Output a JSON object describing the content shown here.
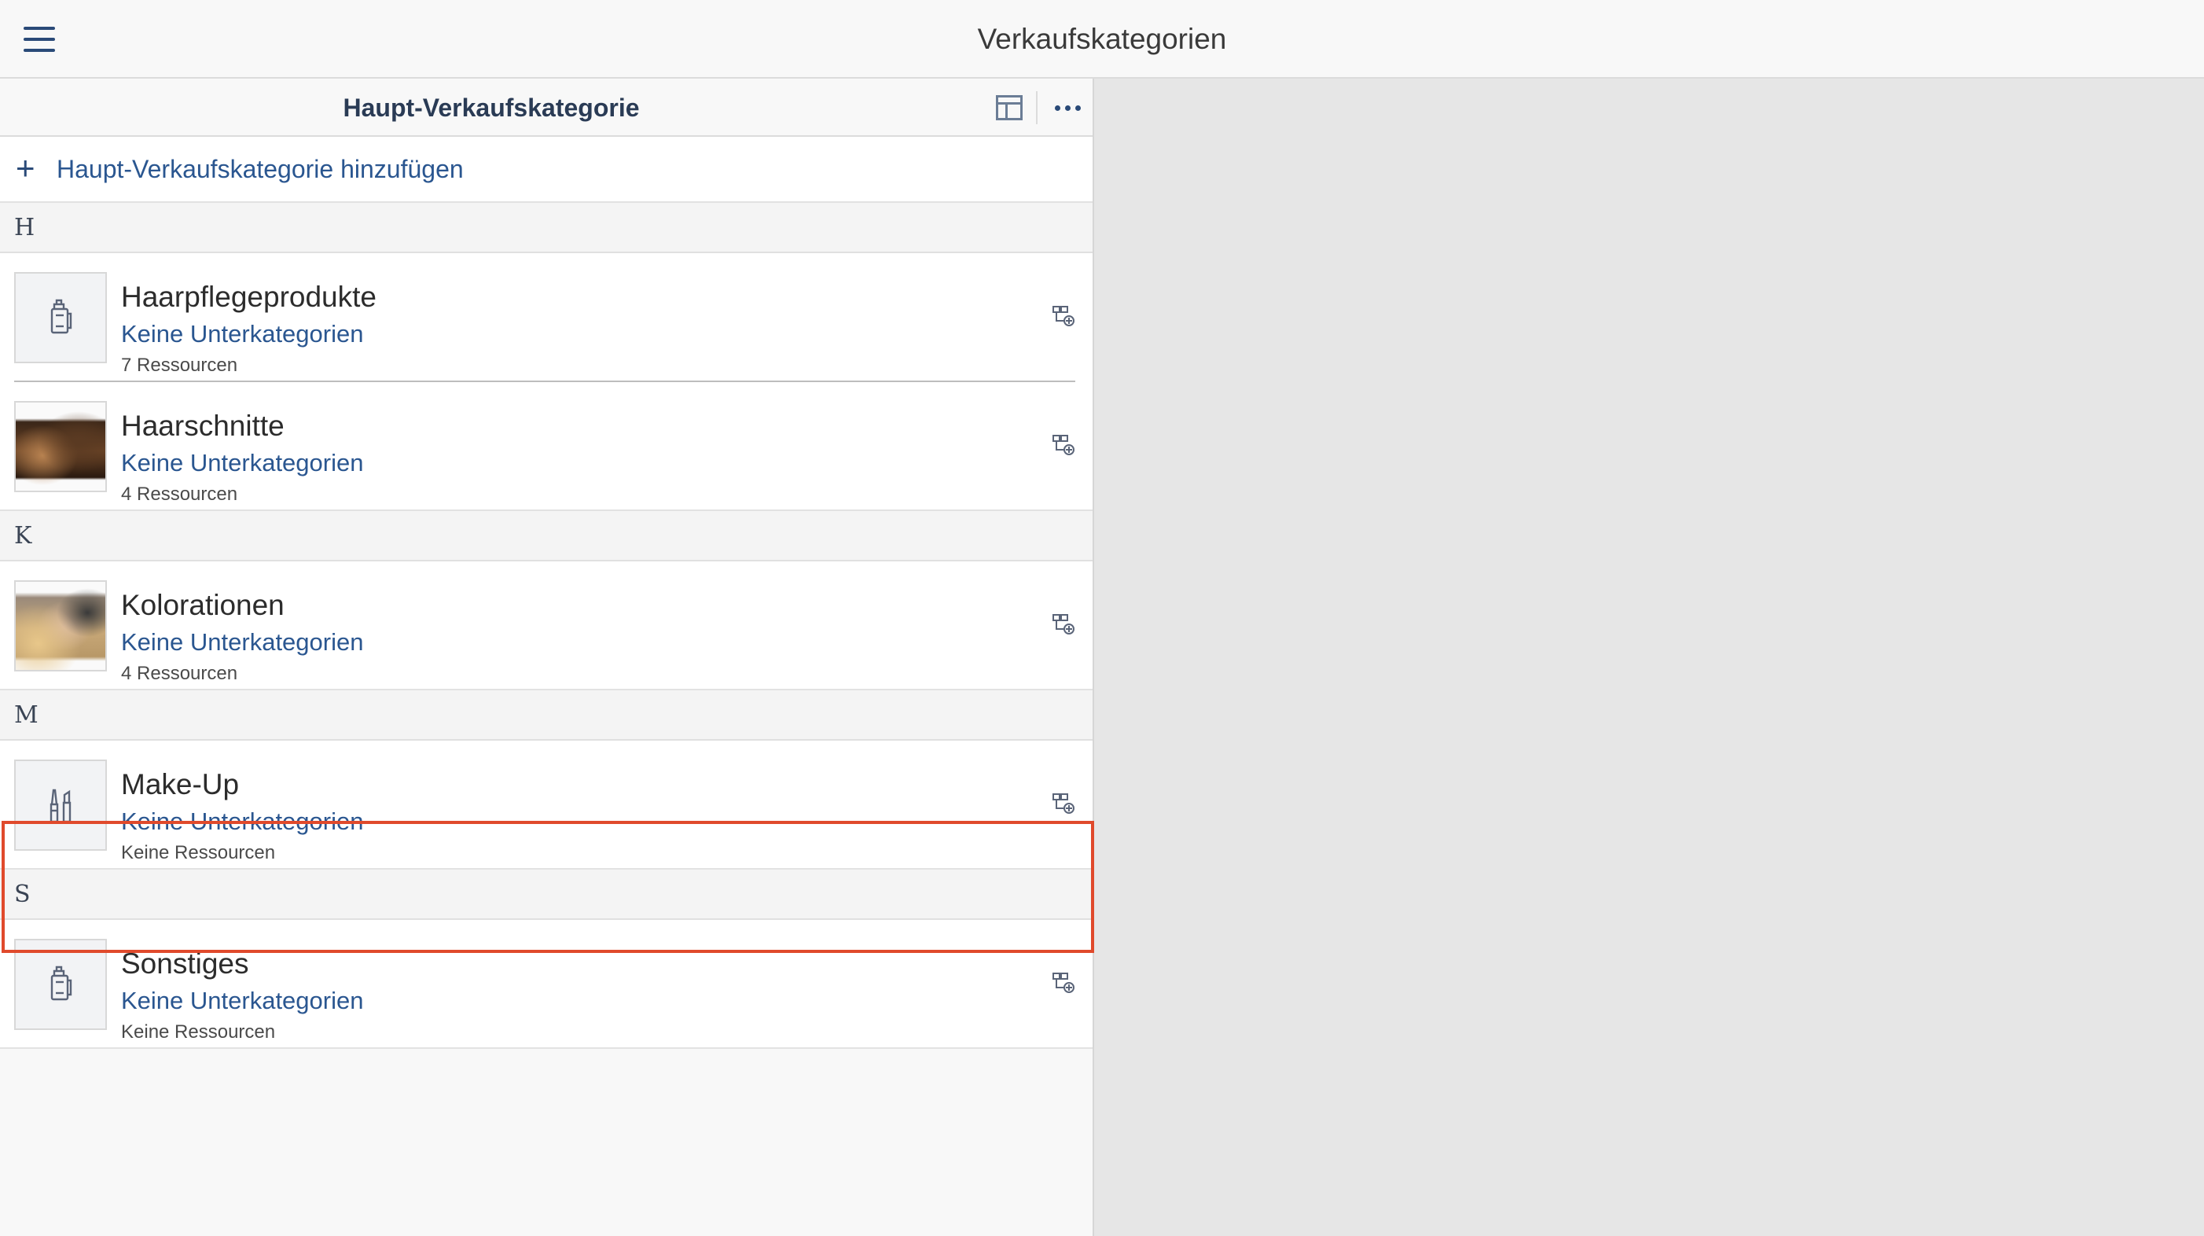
{
  "app": {
    "title": "Verkaufskategorien"
  },
  "panel": {
    "title": "Haupt-Verkaufskategorie",
    "add_label": "Haupt-Verkaufskategorie hinzufügen"
  },
  "sections": [
    {
      "letter": "H",
      "items": [
        {
          "title": "Haarpflegeprodukte",
          "sub": "Keine Unterkategorien",
          "resources": "7 Ressourcen",
          "thumb": "product-icon"
        },
        {
          "title": "Haarschnitte",
          "sub": "Keine Unterkategorien",
          "resources": "4 Ressourcen",
          "thumb": "haircut-photo"
        }
      ]
    },
    {
      "letter": "K",
      "items": [
        {
          "title": "Kolorationen",
          "sub": "Keine Unterkategorien",
          "resources": "4 Ressourcen",
          "thumb": "coloring-photo"
        }
      ]
    },
    {
      "letter": "M",
      "items": [
        {
          "title": "Make-Up",
          "sub": "Keine Unterkategorien",
          "resources": "Keine Ressourcen",
          "thumb": "makeup-icon",
          "highlighted": true
        }
      ]
    },
    {
      "letter": "S",
      "items": [
        {
          "title": "Sonstiges",
          "sub": "Keine Unterkategorien",
          "resources": "Keine Ressourcen",
          "thumb": "product-icon"
        }
      ]
    }
  ],
  "colors": {
    "accent": "#2a5690",
    "highlight_border": "#e04a2c"
  }
}
